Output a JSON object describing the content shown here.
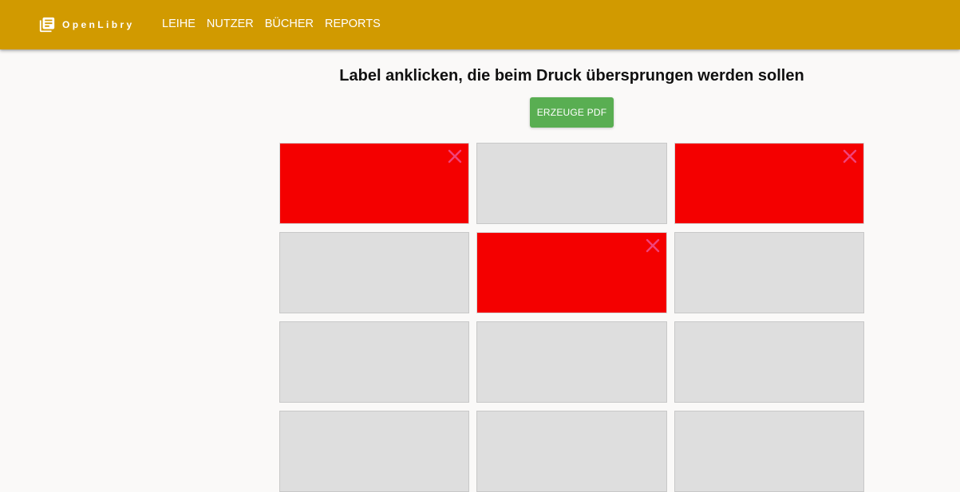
{
  "app": {
    "brand": "OpenLibry",
    "nav": [
      "LEIHE",
      "NUTZER",
      "BÜCHER",
      "REPORTS"
    ]
  },
  "main": {
    "title": "Label anklicken, die beim Druck übersprungen werden sollen",
    "pdf_button": "ERZEUGE PDF"
  },
  "labels": [
    {
      "skipped": true
    },
    {
      "skipped": false
    },
    {
      "skipped": true
    },
    {
      "skipped": false
    },
    {
      "skipped": true
    },
    {
      "skipped": false
    },
    {
      "skipped": false
    },
    {
      "skipped": false
    },
    {
      "skipped": false
    },
    {
      "skipped": false
    },
    {
      "skipped": false
    },
    {
      "skipped": false
    }
  ],
  "colors": {
    "appbar": "#d19a00",
    "button": "#59ae52",
    "skipped": "#f40000",
    "skip_icon": "#f0437a",
    "label": "#dedede"
  }
}
